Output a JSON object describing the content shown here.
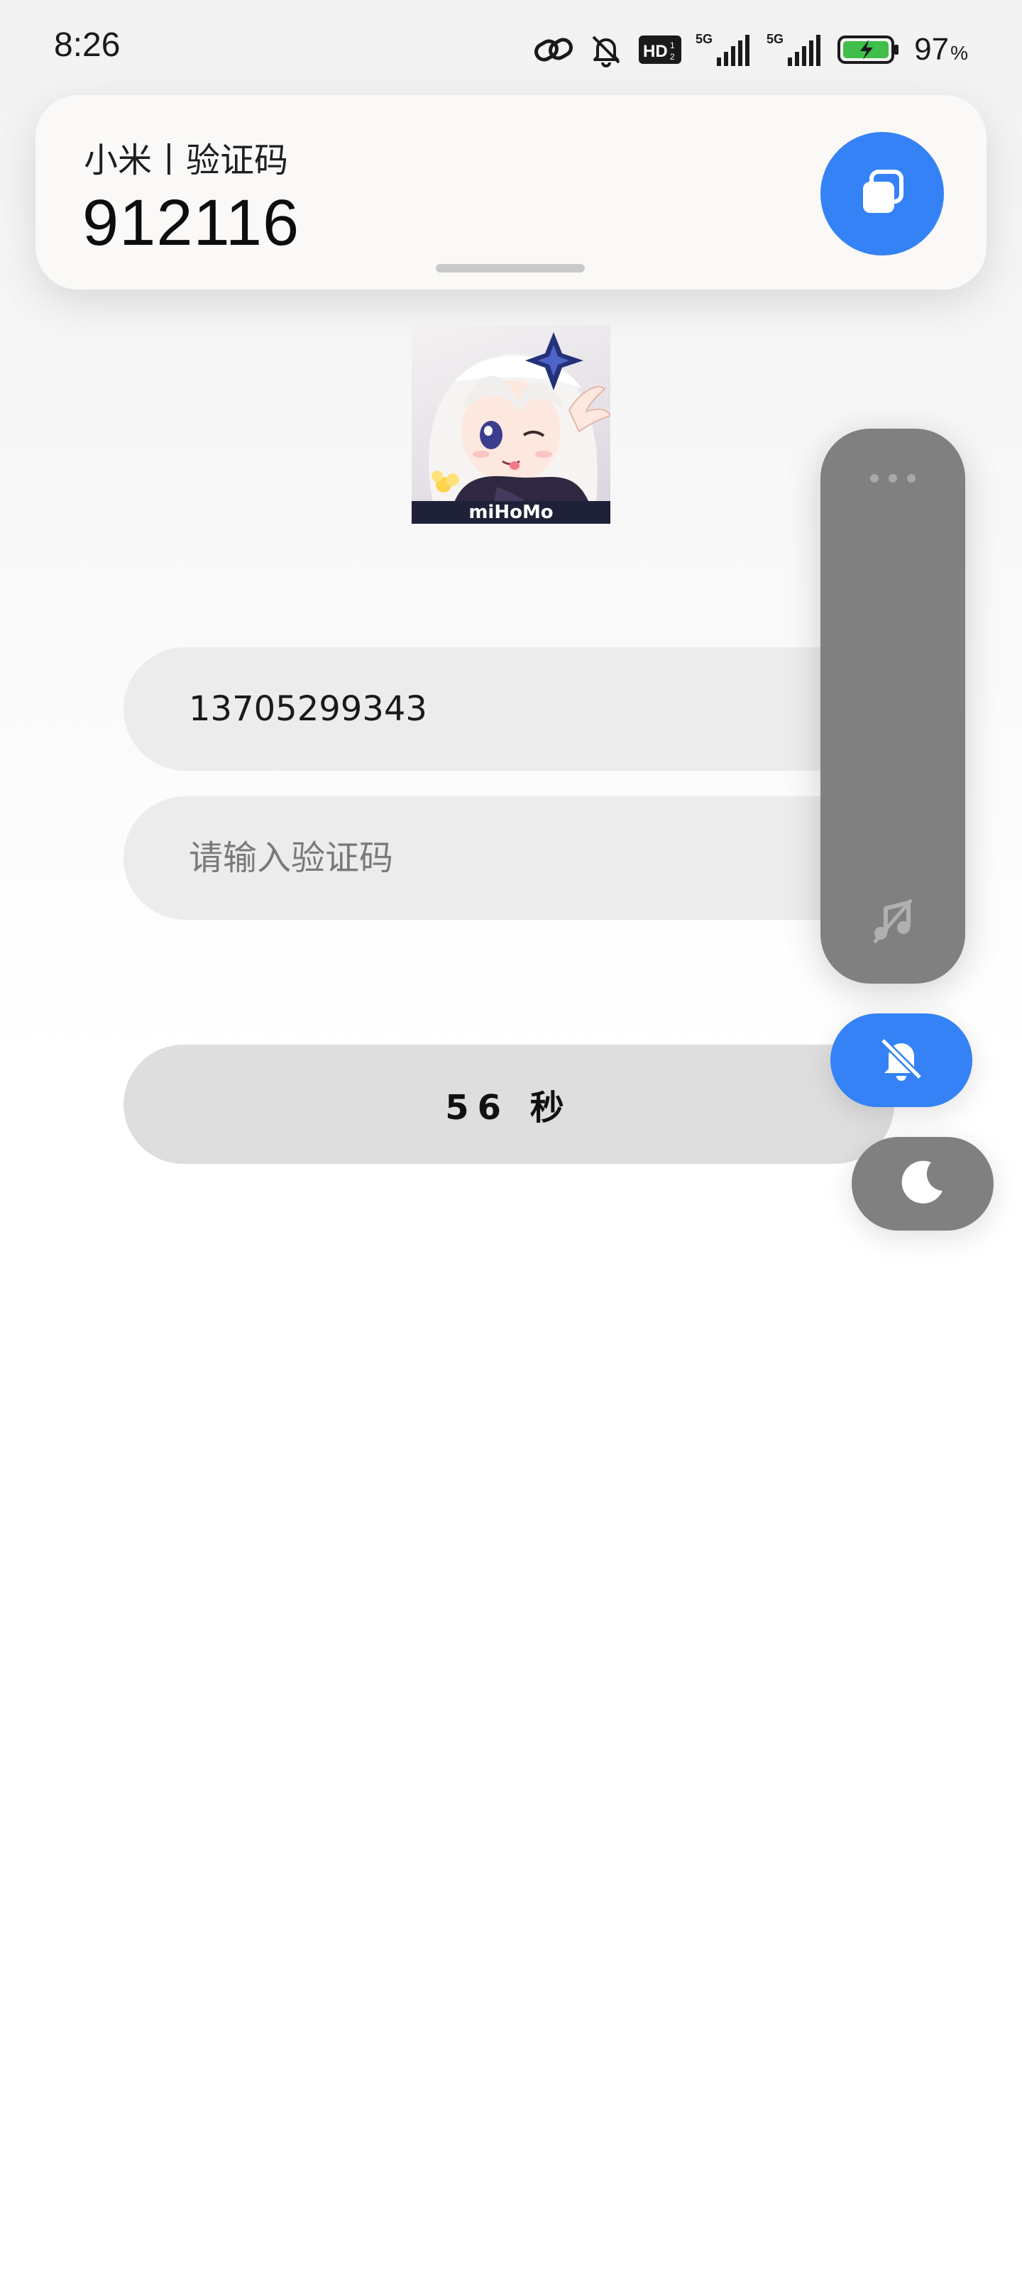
{
  "status_bar": {
    "time": "8:26",
    "battery_percent": "97",
    "battery_unit": "%",
    "icons": [
      "link-icon",
      "bell-muted-icon",
      "hd-icon",
      "signal-5g-icon",
      "signal-5g-icon",
      "battery-charging-icon"
    ]
  },
  "notification": {
    "title": "小米丨验证码",
    "code": "912116",
    "action_icon": "copy-icon"
  },
  "app_logo": {
    "text": "miHoMo"
  },
  "form": {
    "phone_value": "13705299343",
    "code_placeholder": "请输入验证码",
    "countdown_label": "56 秒"
  },
  "volume_panel": {
    "icons": [
      "more-dots-icon",
      "music-muted-icon",
      "bell-muted-icon",
      "moon-icon"
    ]
  },
  "colors": {
    "accent": "#3482f6",
    "panel_gray": "#808080",
    "field_bg": "#ececec",
    "button_bg": "#dedede"
  }
}
